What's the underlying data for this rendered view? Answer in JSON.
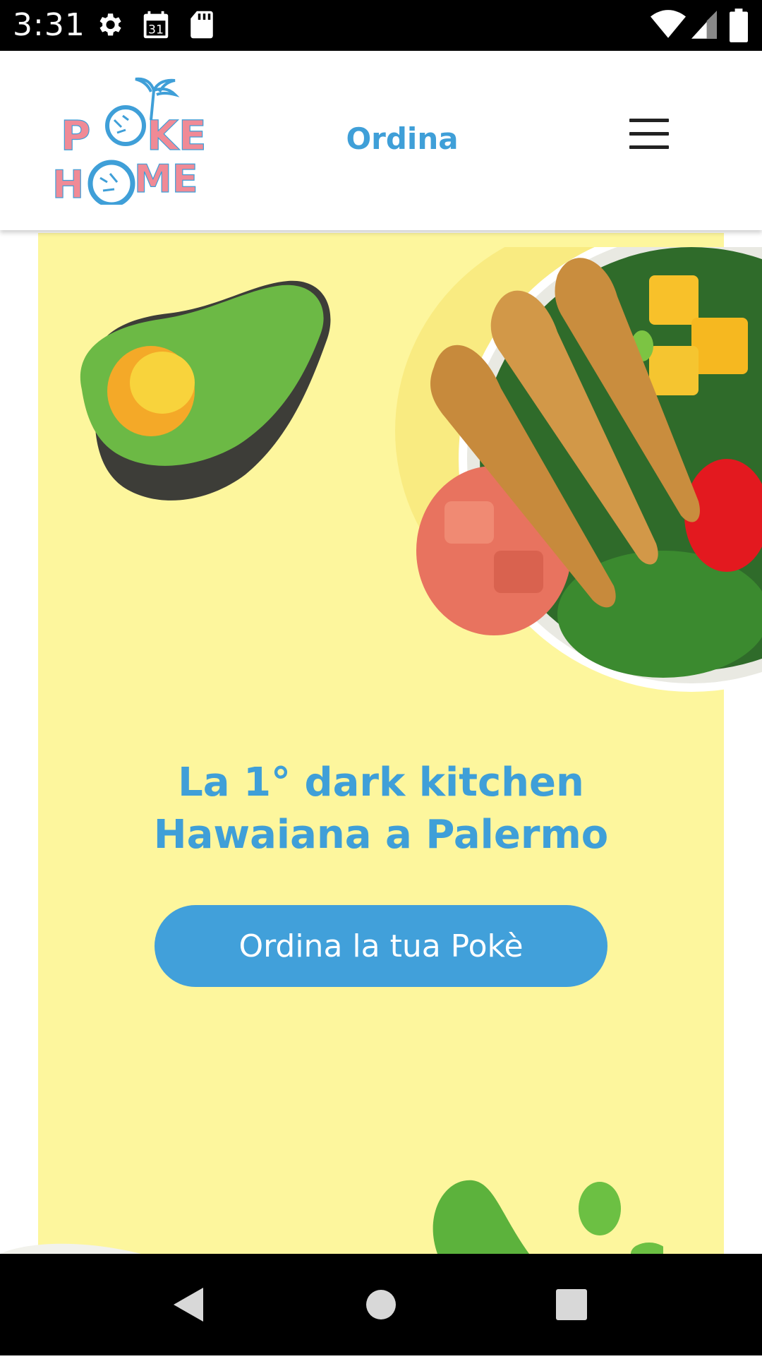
{
  "status_bar": {
    "time": "3:31",
    "calendar_day": "31",
    "icons": [
      "gear-icon",
      "calendar-icon",
      "sd-card-icon",
      "wifi-icon",
      "signal-icon",
      "battery-icon"
    ]
  },
  "header": {
    "logo_text_line1": "POKE",
    "logo_text_line2": "HOME",
    "order_link": "Ordina",
    "menu_icon": "hamburger-menu-icon"
  },
  "hero": {
    "title_line1": "La 1° dark kitchen",
    "title_line2": "Hawaiana a Palermo",
    "cta_label": "Ordina la tua Pokè",
    "background_color": "#fdf69d",
    "accent_color": "#3f9fd8"
  },
  "nav_bar": {
    "icons": [
      "back-icon",
      "home-icon",
      "recents-icon"
    ]
  }
}
